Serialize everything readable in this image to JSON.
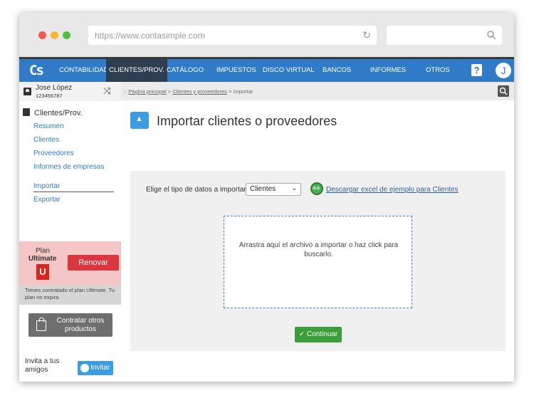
{
  "browser": {
    "url": "https://www.contasimple.com",
    "search_placeholder": ""
  },
  "nav": {
    "logo": "Cs",
    "items": [
      {
        "label": "CONTABILIDAD"
      },
      {
        "label": "CLIENTES/PROV."
      },
      {
        "label": "CATÁLOGO"
      },
      {
        "label": "IMPUESTOS"
      },
      {
        "label": "DISCO VIRTUAL"
      },
      {
        "label": "BANCOS"
      },
      {
        "label": "INFORMES"
      },
      {
        "label": "OTROS"
      }
    ],
    "active": "CLIENTES/PROV.",
    "help": "?",
    "avatar": "J"
  },
  "user": {
    "name": "Jose López",
    "id": "123456787"
  },
  "sidebar": {
    "section_title": "Clientes/Prov.",
    "links": [
      {
        "label": "Resumen"
      },
      {
        "label": "Clientes"
      },
      {
        "label": "Proveedores"
      },
      {
        "label": "Informes de empresas"
      },
      {
        "label": "Importar"
      },
      {
        "label": "Exportar"
      }
    ],
    "plan": {
      "label": "Plan",
      "name": "Ultimate",
      "badge": "U",
      "renew": "Renovar",
      "note": "Tienes contratado el plan Ultimate. Tu plan no expira."
    },
    "contract": "Contratar otros productos",
    "invite_text": "Invita a tus amigos",
    "invite_button": "Invitar"
  },
  "breadcrumb": {
    "prefix": "::",
    "home": "Página principal",
    "section": "Clientes y proveedores",
    "current": "Importar"
  },
  "main": {
    "title": "Importar clientes o proveedores",
    "type_label": "Elige el tipo de datos a importar:",
    "type_value": "Clientes",
    "download_link": "Descargar excel de ejemplo para Clientes",
    "drop_text": "Arrastra aquí el archivo a importar o haz click para buscarlo.",
    "continue": "Continuar"
  },
  "colors": {
    "nav": "#2f7bc7",
    "nav_active": "#2c3e50",
    "renew": "#d9363e",
    "continue": "#3a9e3a",
    "link": "#2f7bc7"
  }
}
